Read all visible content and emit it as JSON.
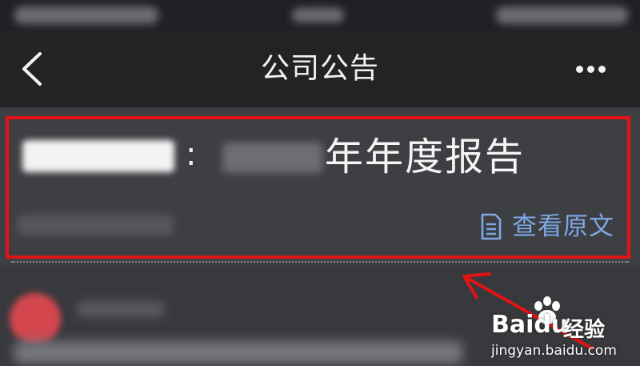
{
  "nav": {
    "title": "公司公告",
    "back_icon": "chevron-left-icon",
    "more_icon": "more-horizontal-icon"
  },
  "announcement": {
    "colon": ":",
    "title_suffix": "年年度报告",
    "view_original": {
      "label": "查看原文",
      "icon": "document-icon",
      "color": "#7ea7e6"
    }
  },
  "annotation": {
    "box_color": "#e01414",
    "arrow_color": "#e01414"
  },
  "watermark": {
    "brand": "Bai",
    "brand_suffix": "du",
    "product": "经验",
    "url": "jingyan.baidu.com"
  }
}
